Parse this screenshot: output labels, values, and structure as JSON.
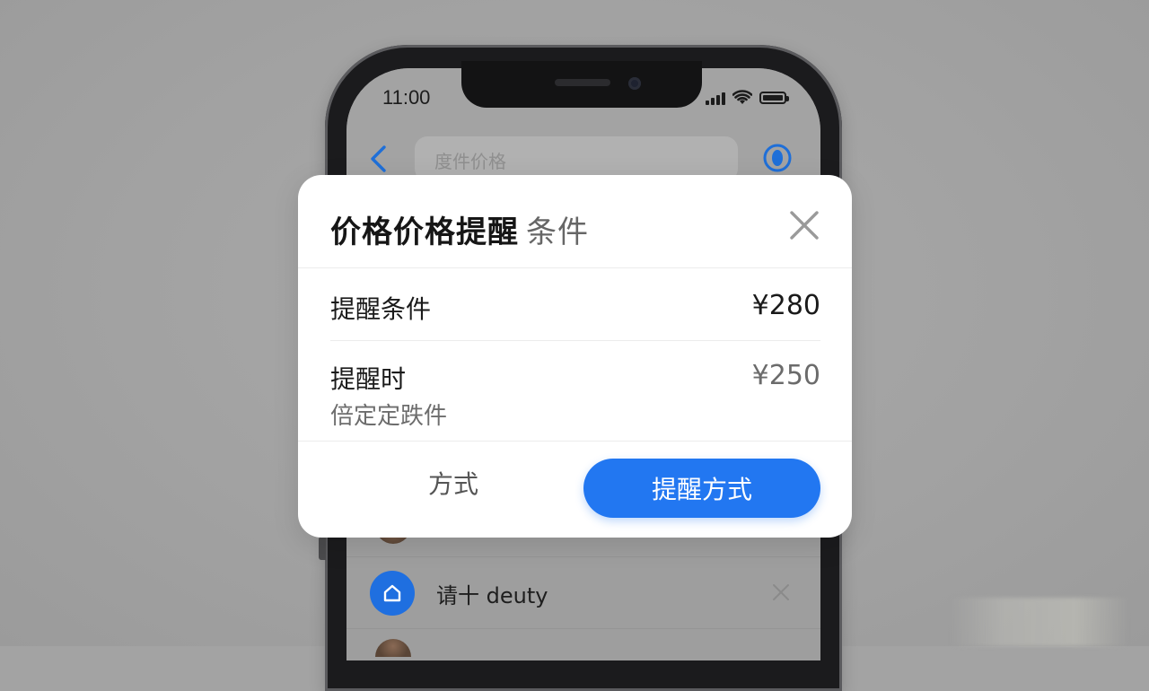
{
  "status_bar": {
    "time": "11:00"
  },
  "nav": {
    "search_placeholder": "度件价格"
  },
  "modal": {
    "title": "价格价格提醒",
    "subtitle": "条件",
    "rows": [
      {
        "label": "提醒条件",
        "value": "¥280"
      },
      {
        "label": "提醒时",
        "sublabel": "倍定定跌件",
        "value": "¥250"
      }
    ],
    "secondary_button": "方式",
    "primary_button": "提醒方式"
  },
  "list": {
    "item_text": "请十 deuty"
  },
  "colors": {
    "accent": "#2277f1",
    "overlay": "#a3a3a3",
    "modal_bg": "#ffffff"
  },
  "icons": {
    "back": "chevron-left-icon",
    "profile": "user-circle-icon",
    "close": "close-icon",
    "list_item": "home-icon",
    "list_action": "x-icon"
  }
}
